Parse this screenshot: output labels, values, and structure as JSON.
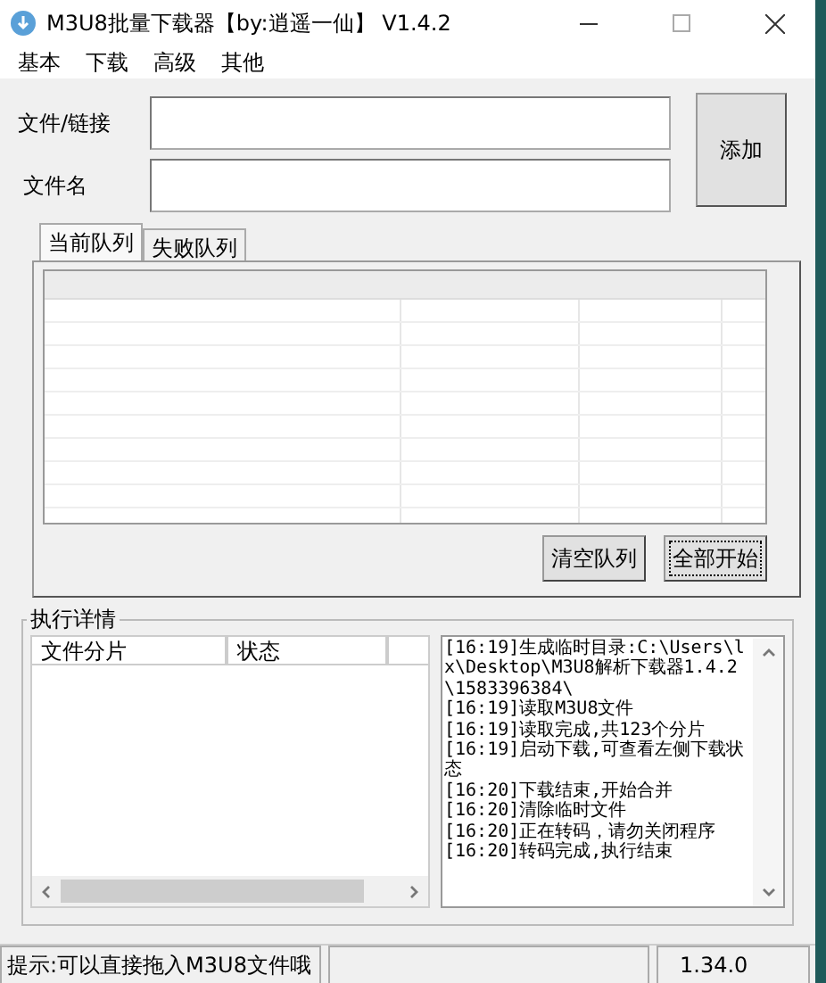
{
  "window": {
    "title": "M3U8批量下载器【by:逍遥一仙】 V1.4.2"
  },
  "menu": [
    "基本",
    "下载",
    "高级",
    "其他"
  ],
  "form": {
    "fields": [
      {
        "label": "文件/链接"
      },
      {
        "label": "文件名"
      }
    ],
    "add_button": "添加"
  },
  "tabs": [
    {
      "label": "当前队列",
      "selected": true
    },
    {
      "label": "失败队列",
      "selected": false
    }
  ],
  "queue_buttons": [
    {
      "label": "清空队列",
      "focused": false
    },
    {
      "label": "全部开始",
      "focused": true
    }
  ],
  "details": {
    "title": "执行详情",
    "columns": [
      "文件分片",
      "状态"
    ],
    "log": [
      "[16:19]生成临时目录:C:\\Users\\lx\\Desktop\\M3U8解析下载器1.4.2\\1583396384\\",
      "[16:19]读取M3U8文件",
      "[16:19]读取完成,共123个分片",
      "[16:19]启动下载,可查看左侧下载状态",
      "[16:20]下载结束,开始合并",
      "[16:20]清除临时文件",
      "[16:20]正在转码，请勿关闭程序",
      "[16:20]转码完成,执行结束"
    ]
  },
  "status_bar": {
    "hint": "提示:可以直接拖入M3U8文件哦",
    "version": "1.34.0"
  }
}
